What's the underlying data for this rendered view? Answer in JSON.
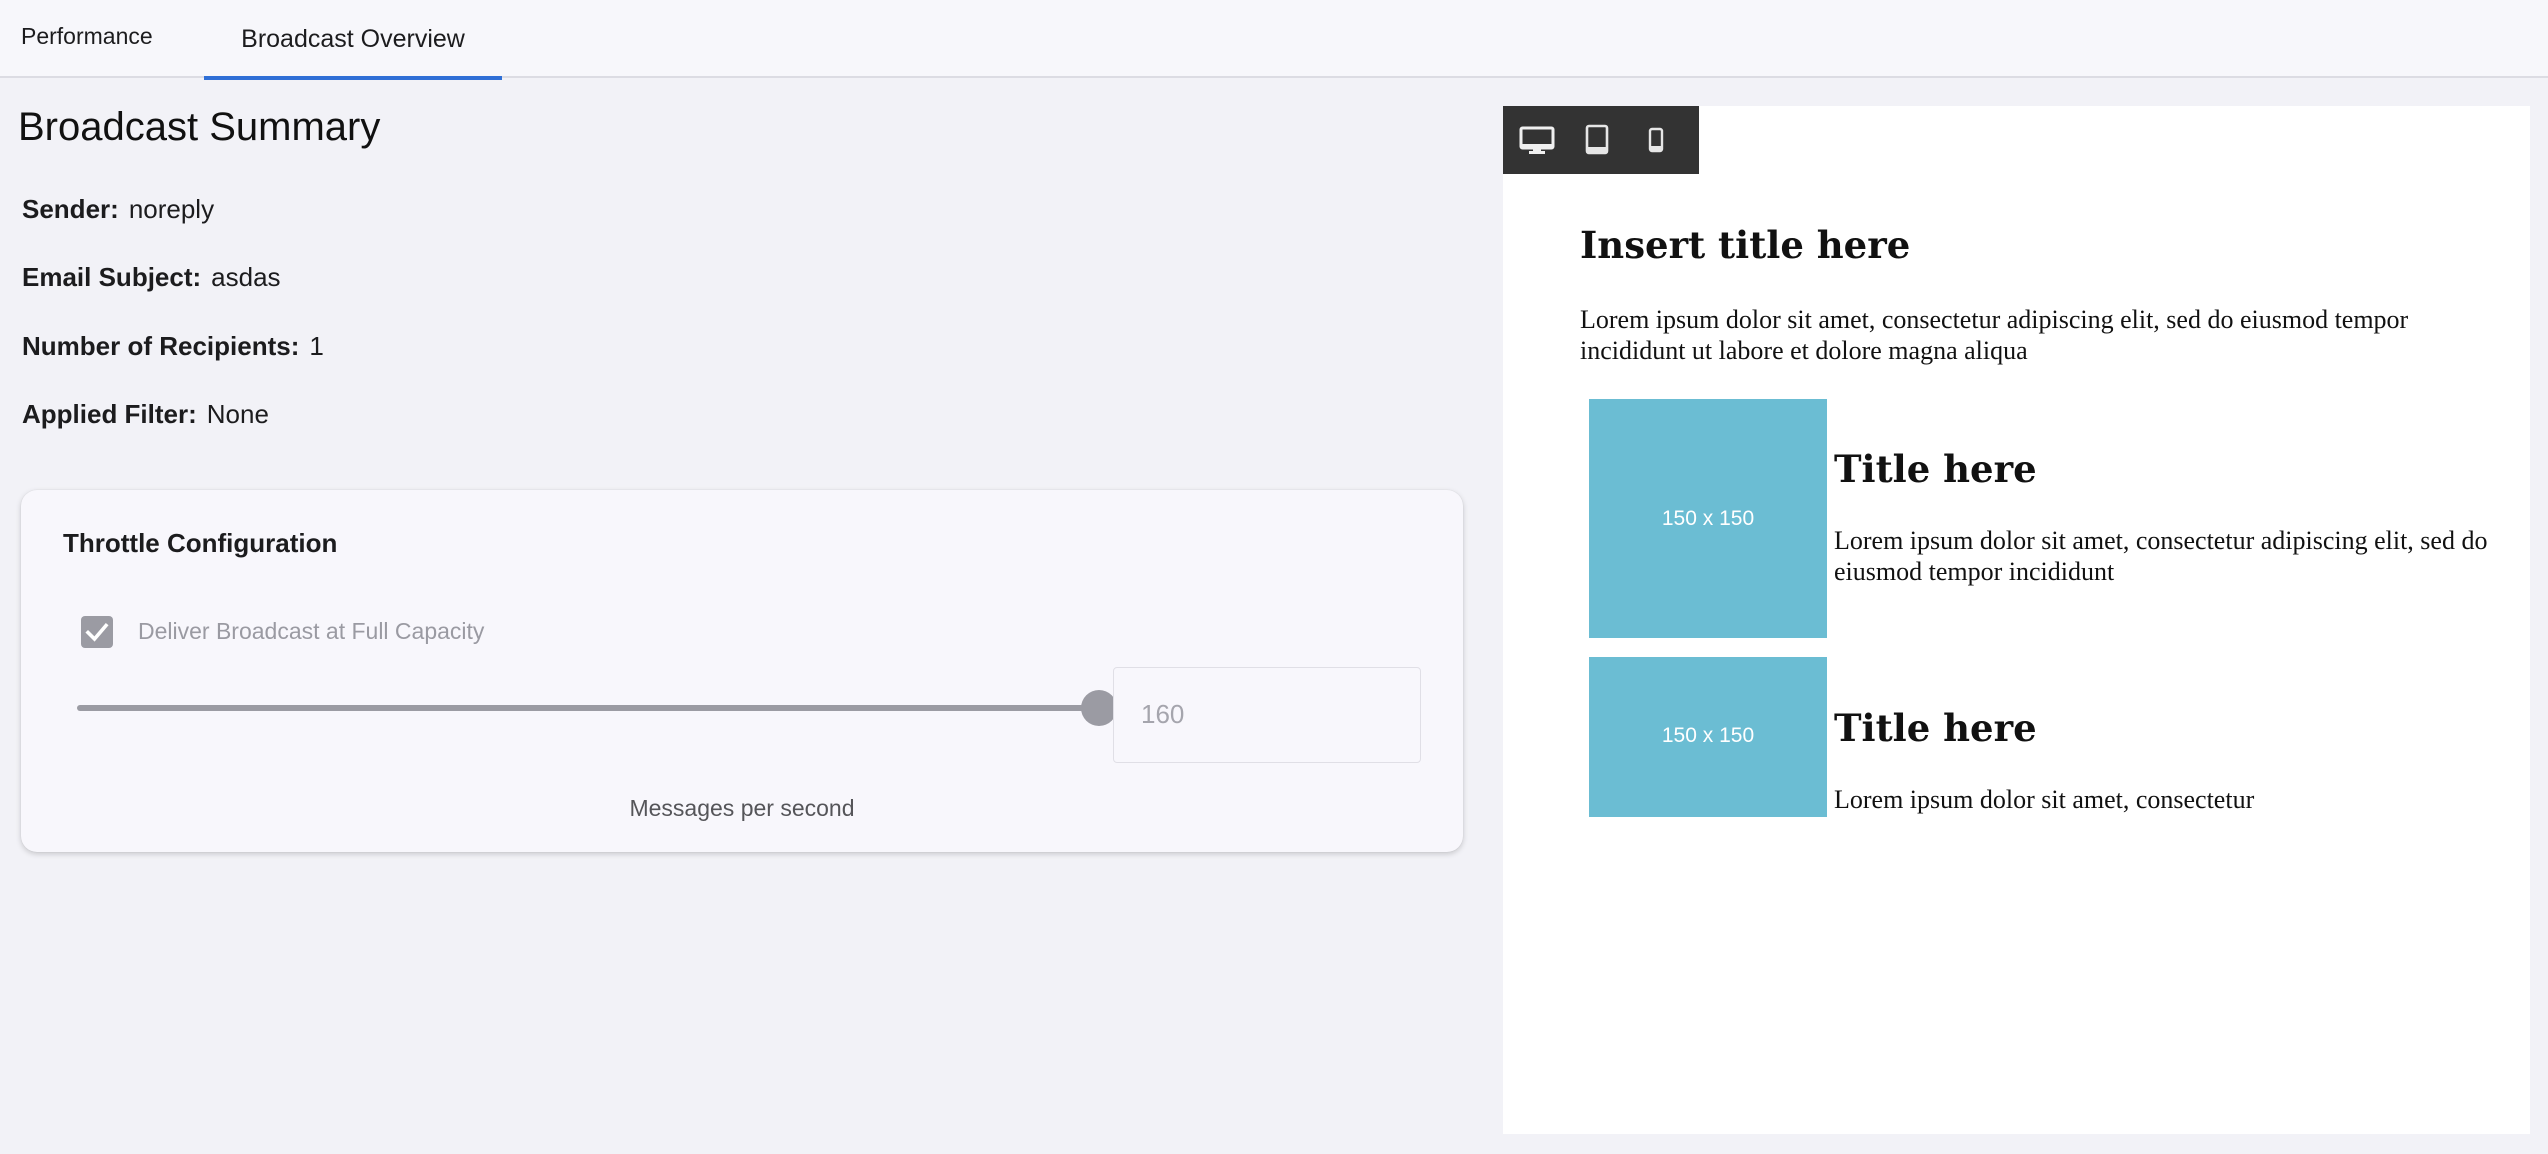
{
  "tabs": [
    {
      "label": "Performance",
      "active": false
    },
    {
      "label": "Broadcast Overview",
      "active": true
    }
  ],
  "summary": {
    "title": "Broadcast Summary",
    "sender": {
      "label": "Sender:",
      "value": "noreply"
    },
    "subject": {
      "label": "Email Subject:",
      "value": "asdas"
    },
    "recipients": {
      "label": "Number of Recipients:",
      "value": "1"
    },
    "filter": {
      "label": "Applied Filter:",
      "value": "None"
    }
  },
  "throttle": {
    "title": "Throttle Configuration",
    "full_capacity_label": "Deliver Broadcast at Full Capacity",
    "full_capacity_checked": true,
    "slider_fraction": 1.0,
    "rate_value": "160",
    "rate_caption": "Messages per second"
  },
  "preview": {
    "devices": [
      "desktop-icon",
      "tablet-icon",
      "phone-icon"
    ],
    "selected_device": "desktop",
    "heading": "Insert title here",
    "intro": "Lorem ipsum dolor sit amet, consectetur adipiscing elit, sed do eiusmod tempor incididunt ut labore et dolore magna aliqua",
    "items": [
      {
        "image_label": "150 x 150",
        "title": "Title here",
        "text": "Lorem ipsum dolor sit amet, consectetur adipiscing elit, sed do eiusmod tempor incididunt"
      },
      {
        "image_label": "150 x 150",
        "title": "Title here",
        "text": "Lorem ipsum dolor sit amet, consectetur"
      }
    ]
  },
  "colors": {
    "accent": "#2f6fd6",
    "placeholder": "#6bbdd3",
    "disabled": "#9b9ba3"
  }
}
